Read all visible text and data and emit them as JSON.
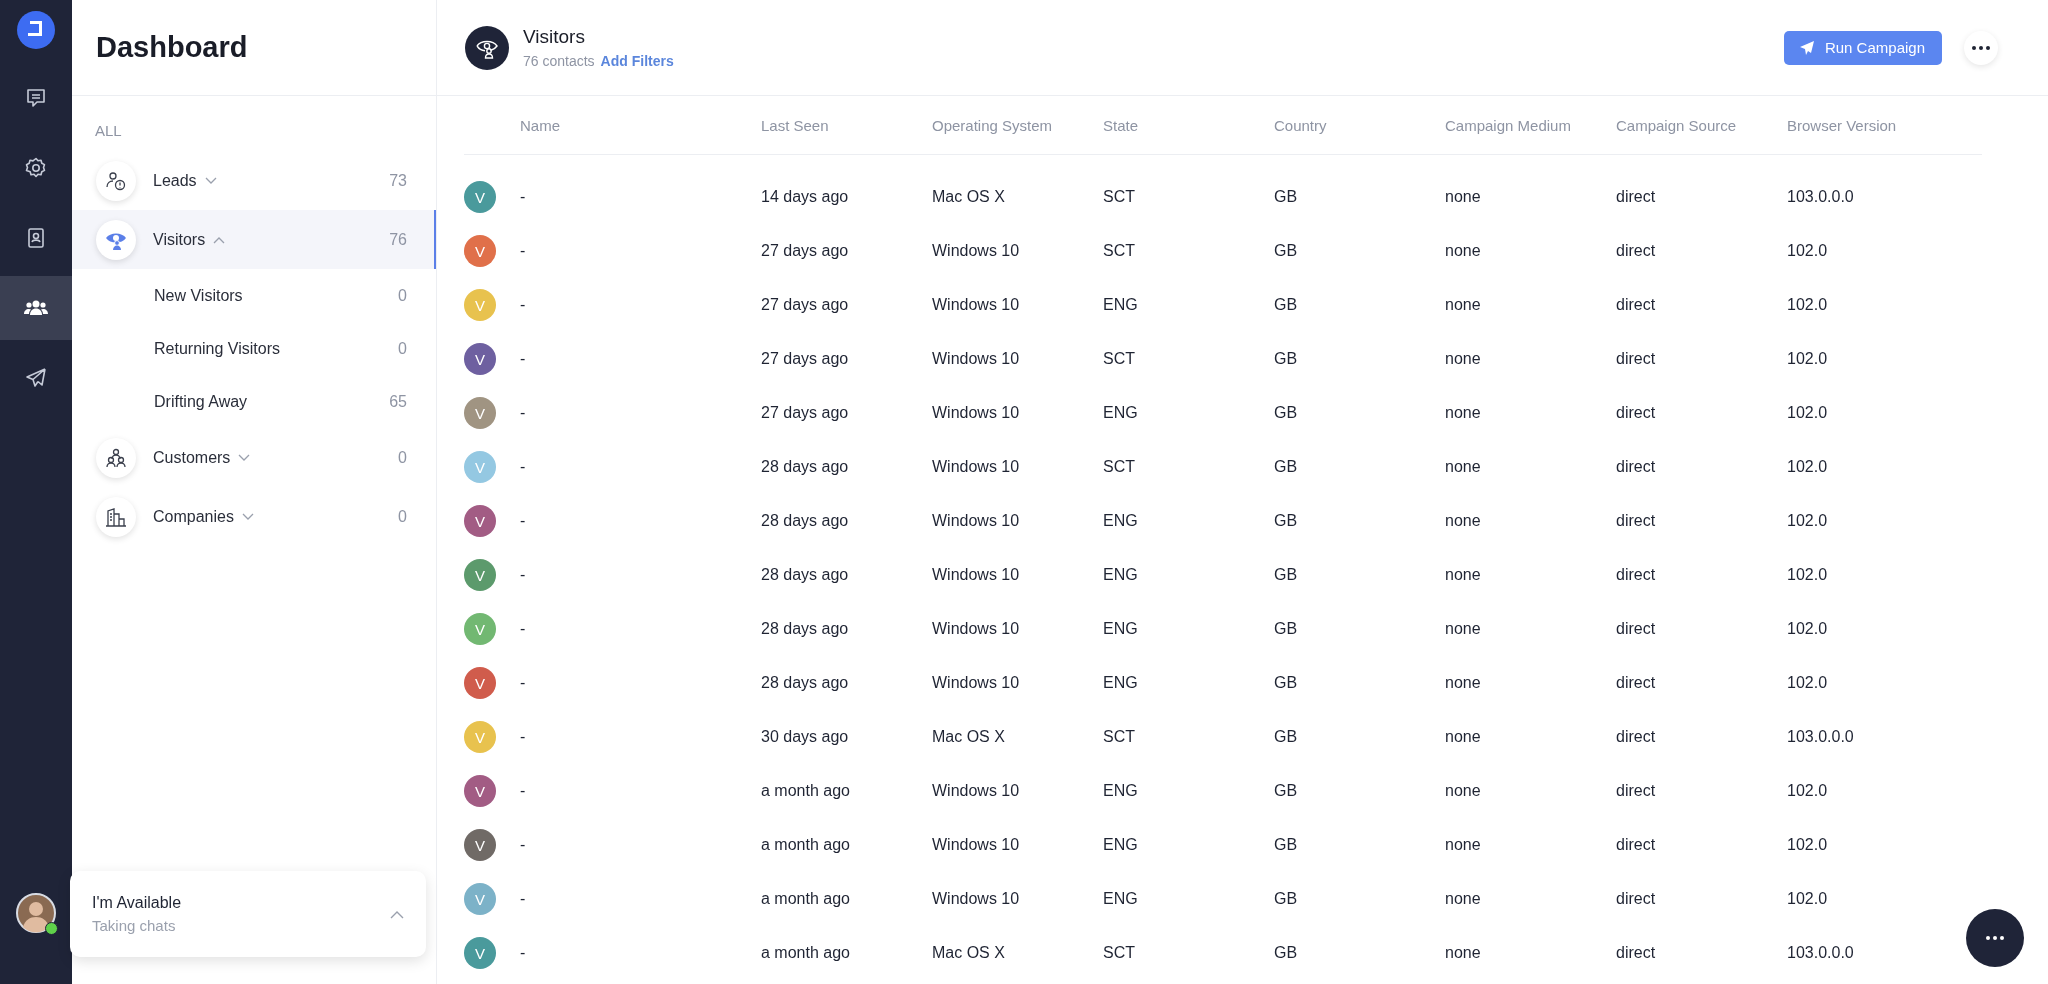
{
  "rail": {
    "items": [
      {
        "kind": "chat",
        "selected": false
      },
      {
        "kind": "gear",
        "selected": false
      },
      {
        "kind": "contacts",
        "selected": false
      },
      {
        "kind": "people",
        "selected": true
      },
      {
        "kind": "send",
        "selected": false
      }
    ]
  },
  "sidebar": {
    "title": "Dashboard",
    "section": "ALL",
    "items": [
      {
        "label": "Leads",
        "kind": "leads",
        "count": "73",
        "selected": false,
        "expanded": false
      },
      {
        "label": "Visitors",
        "kind": "visitors",
        "count": "76",
        "selected": true,
        "expanded": true,
        "children": [
          {
            "label": "New Visitors",
            "count": "0"
          },
          {
            "label": "Returning Visitors",
            "count": "0"
          },
          {
            "label": "Drifting Away",
            "count": "65"
          }
        ]
      },
      {
        "label": "Customers",
        "kind": "customers",
        "count": "0",
        "selected": false,
        "expanded": false
      },
      {
        "label": "Companies",
        "kind": "companies",
        "count": "0",
        "selected": false,
        "expanded": false
      }
    ]
  },
  "status": {
    "title": "I'm Available",
    "subtitle": "Taking chats",
    "online": true
  },
  "header": {
    "title": "Visitors",
    "count": "76 contacts",
    "filter_link": "Add Filters",
    "button": "Run Campaign"
  },
  "table": {
    "columns": [
      "Name",
      "Last Seen",
      "Operating System",
      "State",
      "Country",
      "Campaign Medium",
      "Campaign Source",
      "Browser Version"
    ],
    "rows": [
      {
        "initial": "V",
        "color": "#4a9a9c",
        "cells": [
          "-",
          "14 days ago",
          "Mac OS X",
          "SCT",
          "GB",
          "none",
          "direct",
          "103.0.0.0"
        ]
      },
      {
        "initial": "V",
        "color": "#e0704a",
        "cells": [
          "-",
          "27 days ago",
          "Windows 10",
          "SCT",
          "GB",
          "none",
          "direct",
          "102.0"
        ]
      },
      {
        "initial": "V",
        "color": "#e8c24e",
        "cells": [
          "-",
          "27 days ago",
          "Windows 10",
          "ENG",
          "GB",
          "none",
          "direct",
          "102.0"
        ]
      },
      {
        "initial": "V",
        "color": "#6e60a0",
        "cells": [
          "-",
          "27 days ago",
          "Windows 10",
          "SCT",
          "GB",
          "none",
          "direct",
          "102.0"
        ]
      },
      {
        "initial": "V",
        "color": "#a09482",
        "cells": [
          "-",
          "27 days ago",
          "Windows 10",
          "ENG",
          "GB",
          "none",
          "direct",
          "102.0"
        ]
      },
      {
        "initial": "V",
        "color": "#94c8e2",
        "cells": [
          "-",
          "28 days ago",
          "Windows 10",
          "SCT",
          "GB",
          "none",
          "direct",
          "102.0"
        ]
      },
      {
        "initial": "V",
        "color": "#a25c84",
        "cells": [
          "-",
          "28 days ago",
          "Windows 10",
          "ENG",
          "GB",
          "none",
          "direct",
          "102.0"
        ]
      },
      {
        "initial": "V",
        "color": "#5c9a6c",
        "cells": [
          "-",
          "28 days ago",
          "Windows 10",
          "ENG",
          "GB",
          "none",
          "direct",
          "102.0"
        ]
      },
      {
        "initial": "V",
        "color": "#72b872",
        "cells": [
          "-",
          "28 days ago",
          "Windows 10",
          "ENG",
          "GB",
          "none",
          "direct",
          "102.0"
        ]
      },
      {
        "initial": "V",
        "color": "#d05c4c",
        "cells": [
          "-",
          "28 days ago",
          "Windows 10",
          "ENG",
          "GB",
          "none",
          "direct",
          "102.0"
        ]
      },
      {
        "initial": "V",
        "color": "#e8c24e",
        "cells": [
          "-",
          "30 days ago",
          "Mac OS X",
          "SCT",
          "GB",
          "none",
          "direct",
          "103.0.0.0"
        ]
      },
      {
        "initial": "V",
        "color": "#a25c84",
        "cells": [
          "-",
          "a month ago",
          "Windows 10",
          "ENG",
          "GB",
          "none",
          "direct",
          "102.0"
        ]
      },
      {
        "initial": "V",
        "color": "#706a66",
        "cells": [
          "-",
          "a month ago",
          "Windows 10",
          "ENG",
          "GB",
          "none",
          "direct",
          "102.0"
        ]
      },
      {
        "initial": "V",
        "color": "#7cb2c8",
        "cells": [
          "-",
          "a month ago",
          "Windows 10",
          "ENG",
          "GB",
          "none",
          "direct",
          "102.0"
        ]
      },
      {
        "initial": "V",
        "color": "#4a9a9c",
        "cells": [
          "-",
          "a month ago",
          "Mac OS X",
          "SCT",
          "GB",
          "none",
          "direct",
          "103.0.0.0"
        ]
      }
    ]
  }
}
